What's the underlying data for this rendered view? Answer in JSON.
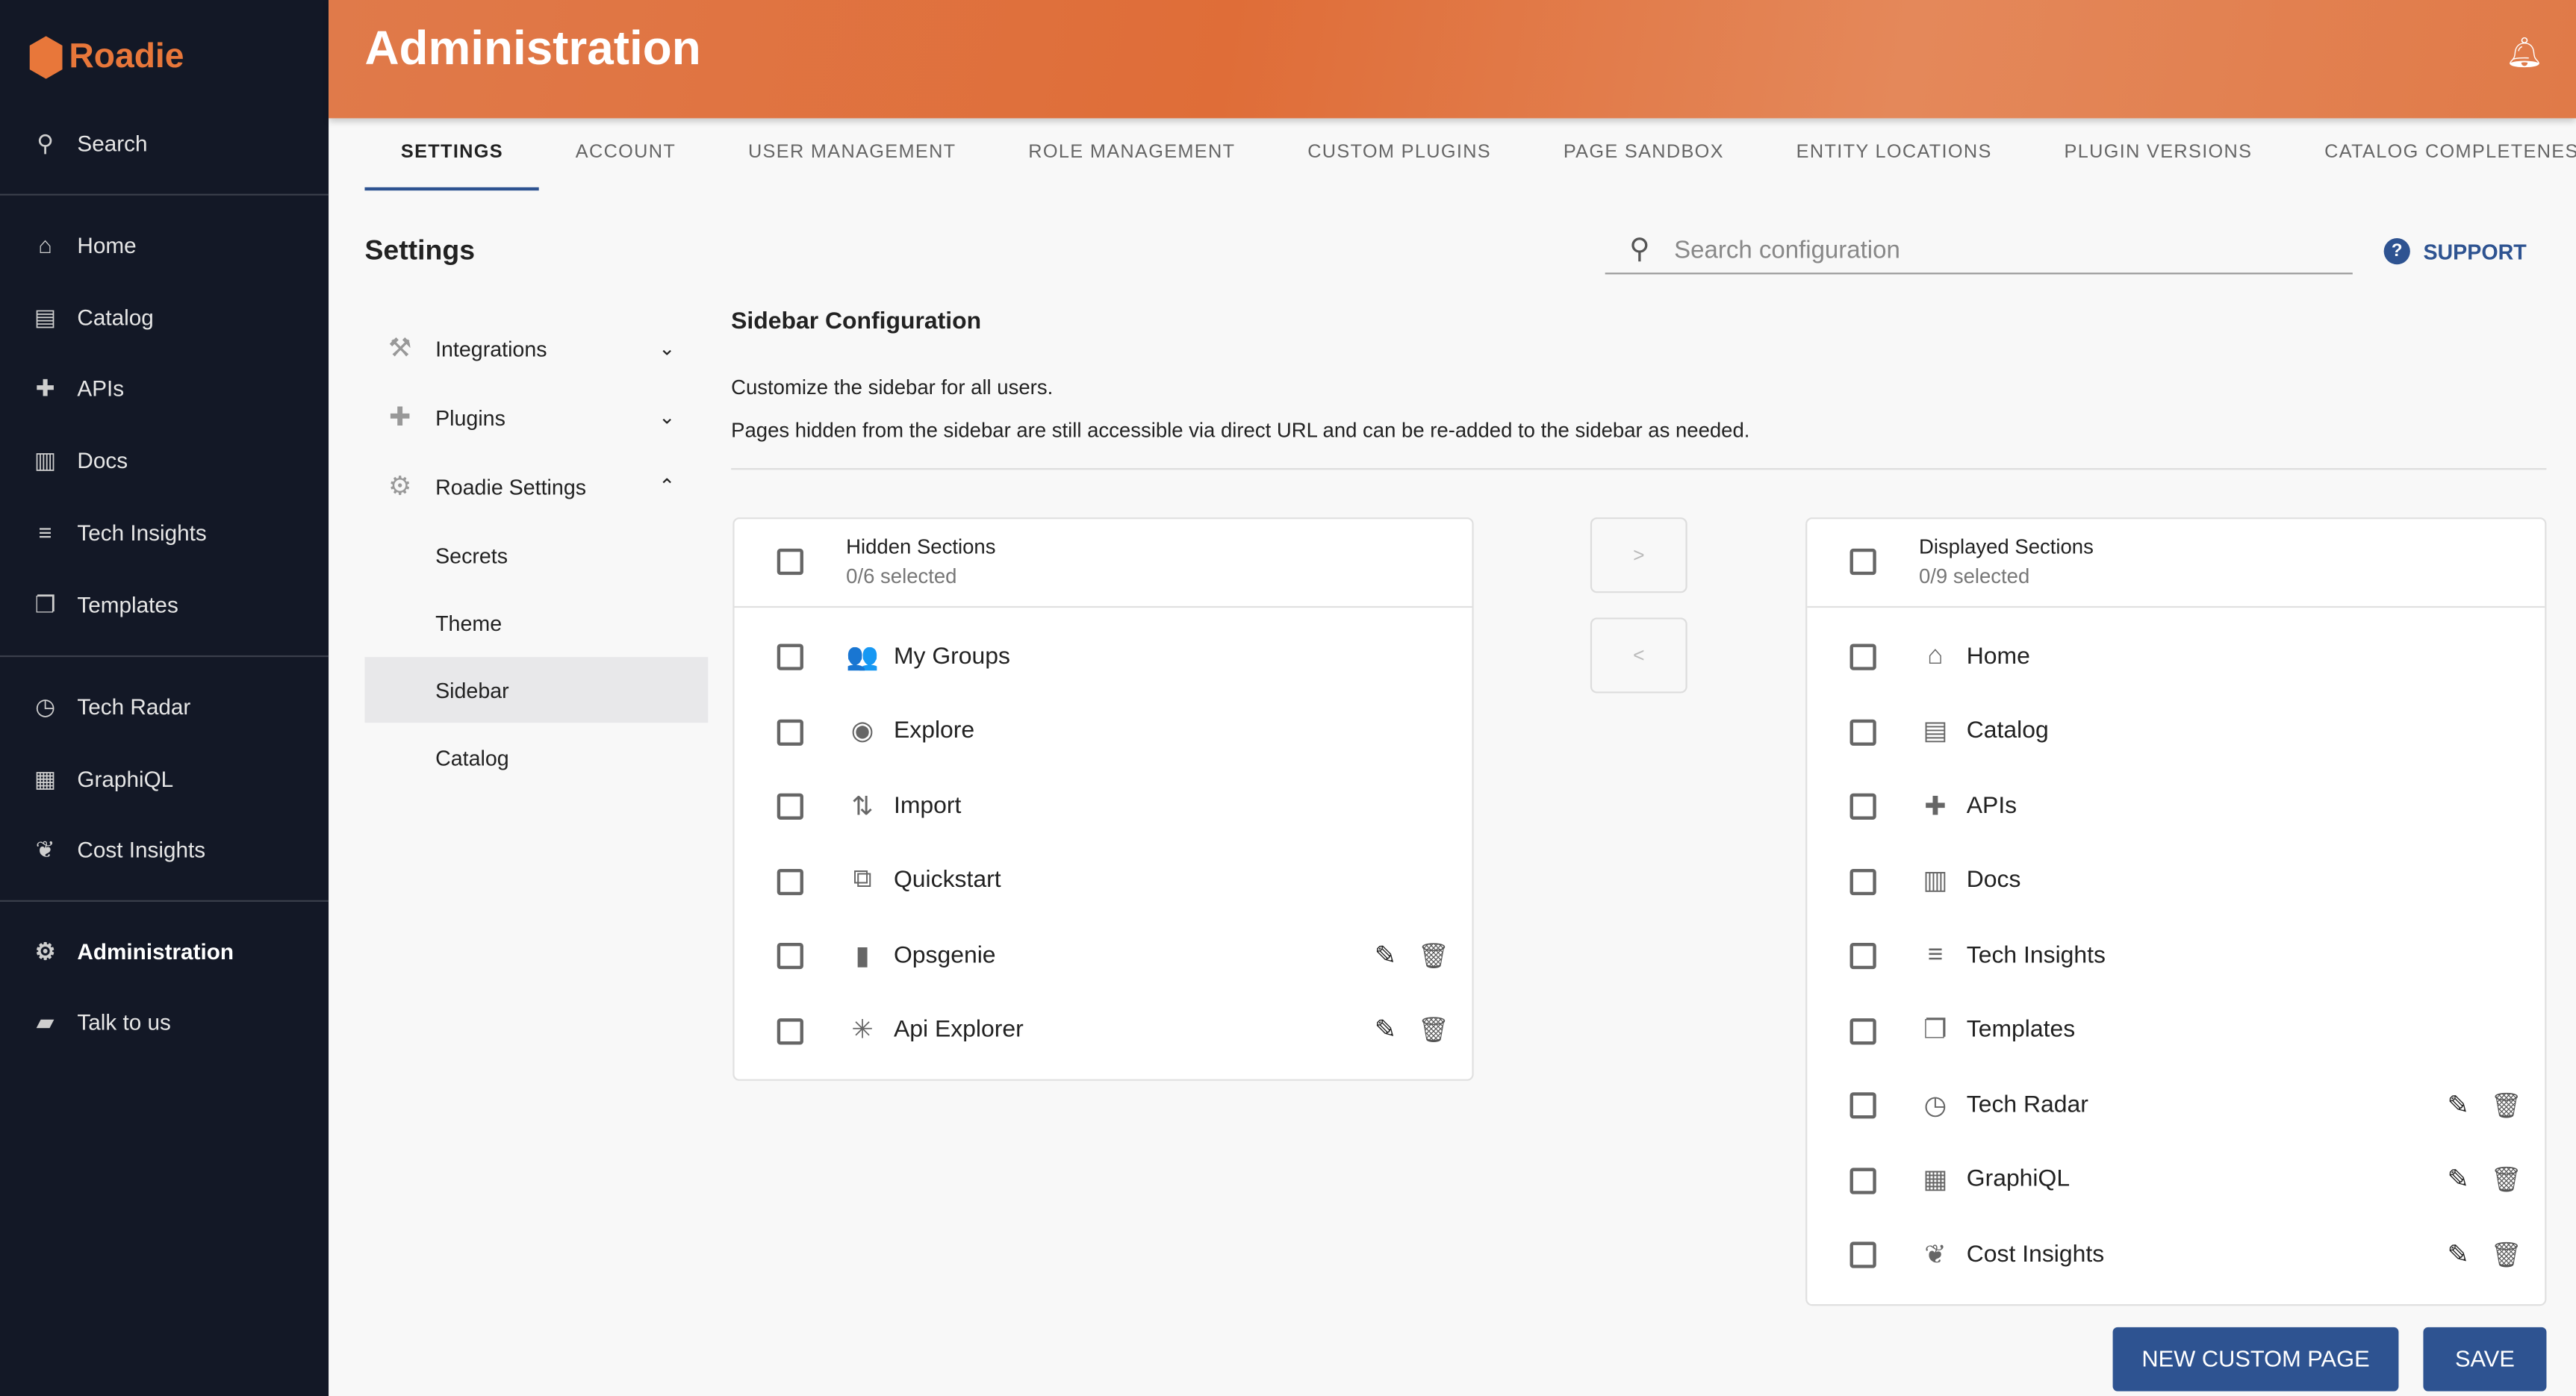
{
  "brand": {
    "name": "Roadie",
    "color": "#e8773a"
  },
  "sidebar": {
    "search": "Search",
    "items": [
      {
        "label": "Home",
        "icon": "home-icon",
        "glyph": "⌂"
      },
      {
        "label": "Catalog",
        "icon": "catalog-icon",
        "glyph": "▤"
      },
      {
        "label": "APIs",
        "icon": "puzzle-icon",
        "glyph": "✚"
      },
      {
        "label": "Docs",
        "icon": "book-icon",
        "glyph": "▥"
      },
      {
        "label": "Tech Insights",
        "icon": "insights-icon",
        "glyph": "≡"
      },
      {
        "label": "Templates",
        "icon": "file-icon",
        "glyph": "❐"
      },
      {
        "label": "Tech Radar",
        "icon": "radar-icon",
        "glyph": "◷"
      },
      {
        "label": "GraphiQL",
        "icon": "graphiql-icon",
        "glyph": "▦"
      },
      {
        "label": "Cost Insights",
        "icon": "leaf-icon",
        "glyph": "❦"
      },
      {
        "label": "Administration",
        "icon": "gear-icon",
        "glyph": "⚙"
      },
      {
        "label": "Talk to us",
        "icon": "chat-icon",
        "glyph": "▰"
      }
    ]
  },
  "header": {
    "title": "Administration"
  },
  "tabs": [
    "SETTINGS",
    "ACCOUNT",
    "USER MANAGEMENT",
    "ROLE MANAGEMENT",
    "CUSTOM PLUGINS",
    "PAGE SANDBOX",
    "ENTITY LOCATIONS",
    "PLUGIN VERSIONS",
    "CATALOG COMPLETENESS"
  ],
  "settings": {
    "title": "Settings",
    "search_placeholder": "Search configuration",
    "support": "SUPPORT",
    "menu": [
      "Integrations",
      "Plugins",
      "Roadie Settings"
    ],
    "submenu": [
      "Secrets",
      "Theme",
      "Sidebar",
      "Catalog"
    ]
  },
  "config": {
    "title": "Sidebar Configuration",
    "desc1": "Customize the sidebar for all users.",
    "desc2": "Pages hidden from the sidebar are still accessible via direct URL and can be re-added to the sidebar as needed.",
    "hidden": {
      "title": "Hidden Sections",
      "count": "0/6 selected",
      "items": [
        {
          "label": "My Groups",
          "glyph": "👥",
          "icon": "groups-icon",
          "custom": false
        },
        {
          "label": "Explore",
          "glyph": "◉",
          "icon": "compass-icon",
          "custom": false
        },
        {
          "label": "Import",
          "glyph": "⇅",
          "icon": "import-icon",
          "custom": false
        },
        {
          "label": "Quickstart",
          "glyph": "⧉",
          "icon": "quickstart-icon",
          "custom": false
        },
        {
          "label": "Opsgenie",
          "glyph": "▮",
          "icon": "opsgenie-icon",
          "custom": true
        },
        {
          "label": "Api Explorer",
          "glyph": "✳",
          "icon": "snowflake-icon",
          "custom": true
        }
      ]
    },
    "displayed": {
      "title": "Displayed Sections",
      "count": "0/9 selected",
      "items": [
        {
          "label": "Home",
          "glyph": "⌂",
          "icon": "home-icon",
          "custom": false
        },
        {
          "label": "Catalog",
          "glyph": "▤",
          "icon": "catalog-icon",
          "custom": false
        },
        {
          "label": "APIs",
          "glyph": "✚",
          "icon": "puzzle-icon",
          "custom": false
        },
        {
          "label": "Docs",
          "glyph": "▥",
          "icon": "book-icon",
          "custom": false
        },
        {
          "label": "Tech Insights",
          "glyph": "≡",
          "icon": "insights-icon",
          "custom": false
        },
        {
          "label": "Templates",
          "glyph": "❐",
          "icon": "file-icon",
          "custom": false
        },
        {
          "label": "Tech Radar",
          "glyph": "◷",
          "icon": "radar-icon",
          "custom": true
        },
        {
          "label": "GraphiQL",
          "glyph": "▦",
          "icon": "graphiql-icon",
          "custom": true
        },
        {
          "label": "Cost Insights",
          "glyph": "❦",
          "icon": "leaf-icon",
          "custom": true
        }
      ]
    },
    "move_right": ">",
    "move_left": "<"
  },
  "buttons": {
    "new_page": "NEW CUSTOM PAGE",
    "save": "SAVE"
  },
  "accent": "#2e5391"
}
